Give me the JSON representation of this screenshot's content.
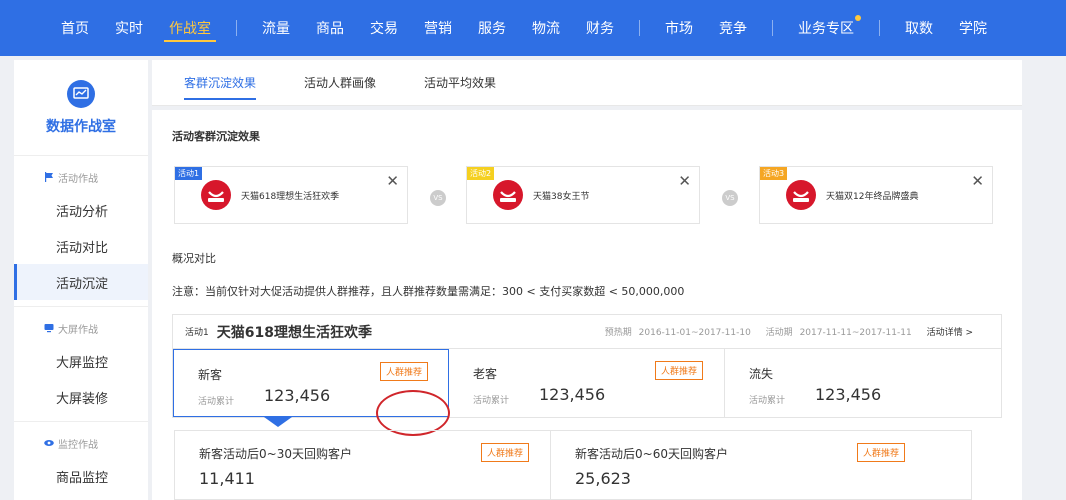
{
  "nav": {
    "items": [
      {
        "label": "首页"
      },
      {
        "label": "实时"
      },
      {
        "label": "作战室",
        "active": true
      },
      {
        "sep": true
      },
      {
        "label": "流量"
      },
      {
        "label": "商品"
      },
      {
        "label": "交易"
      },
      {
        "label": "营销"
      },
      {
        "label": "服务"
      },
      {
        "label": "物流"
      },
      {
        "label": "财务"
      },
      {
        "sep": true
      },
      {
        "label": "市场"
      },
      {
        "label": "竞争"
      },
      {
        "sep": true
      },
      {
        "label": "业务专区",
        "dot": true
      },
      {
        "sep": true
      },
      {
        "label": "取数"
      },
      {
        "label": "学院"
      }
    ],
    "accent": "#2f6fe4",
    "active_color": "#ffc83d"
  },
  "sidebar": {
    "title": "数据作战室",
    "groups": [
      {
        "label": "活动作战",
        "icon": "flag-icon",
        "items": [
          {
            "label": "活动分析"
          },
          {
            "label": "活动对比"
          },
          {
            "label": "活动沉淀",
            "active": true
          }
        ]
      },
      {
        "label": "大屏作战",
        "icon": "monitor-icon",
        "items": [
          {
            "label": "大屏监控"
          },
          {
            "label": "大屏装修"
          }
        ]
      },
      {
        "label": "监控作战",
        "icon": "eye-icon",
        "items": [
          {
            "label": "商品监控"
          }
        ]
      }
    ]
  },
  "tabs": [
    {
      "label": "客群沉淀效果",
      "active": true
    },
    {
      "label": "活动人群画像"
    },
    {
      "label": "活动平均效果"
    }
  ],
  "section": {
    "activities_title": "活动客群沉淀效果",
    "overview_title": "概况对比",
    "notice": "注意：当前仅针对大促活动提供人群推荐，且人群推荐数量需满足：300 < 支付买家数超 < 50,000,000"
  },
  "activities": [
    {
      "tag": "活动1",
      "tag_color": "#2f6fe4",
      "name": "天猫618理想生活狂欢季"
    },
    {
      "tag": "活动2",
      "tag_color": "#f5d020",
      "name": "天猫38女王节"
    },
    {
      "tag": "活动3",
      "tag_color": "#f5a623",
      "name": "天猫双12年终品牌盛典"
    }
  ],
  "vs_label": "VS",
  "comparison": {
    "tag": "活动1",
    "name": "天猫618理想生活狂欢季",
    "preheat_label": "预热期",
    "preheat_range": "2016-11-01~2017-11-10",
    "active_label": "活动期",
    "active_range": "2017-11-11~2017-11-11",
    "detail_link": "活动详情 >",
    "cells": [
      {
        "label": "新客",
        "sub": "活动累计",
        "value": "123,456",
        "button": "人群推荐"
      },
      {
        "label": "老客",
        "sub": "活动累计",
        "value": "123,456",
        "button": "人群推荐"
      },
      {
        "label": "流失",
        "sub": "活动累计",
        "value": "123,456"
      }
    ]
  },
  "sub_cards": [
    {
      "label": "新客活动后0~30天回购客户",
      "value": "11,411",
      "button": "人群推荐"
    },
    {
      "label": "新客活动后0~60天回购客户",
      "value": "25,623",
      "button": "人群推荐"
    }
  ]
}
